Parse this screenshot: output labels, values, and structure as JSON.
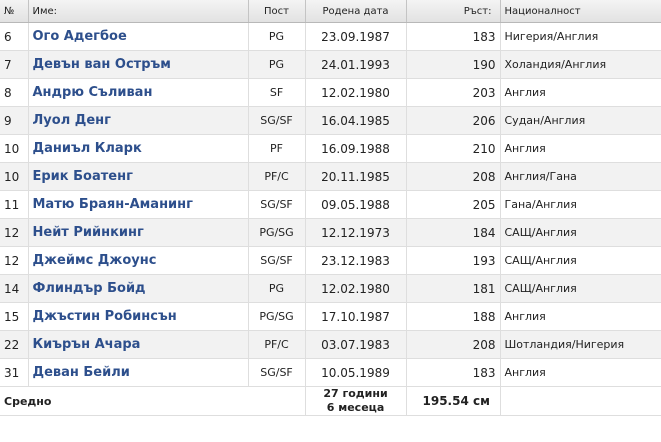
{
  "table": {
    "headers": {
      "number": "№",
      "name": "Име:",
      "position": "Пост",
      "birth_date": "Родена дата",
      "height": "Ръст:",
      "nationality": "Националност"
    },
    "rows": [
      {
        "number": "6",
        "name": "Ого Адегбое",
        "position": "PG",
        "birth_date": "23.09.1987",
        "height": "183",
        "nationality": "Нигерия/Англия"
      },
      {
        "number": "7",
        "name": "Девън ван Остръм",
        "position": "PG",
        "birth_date": "24.01.1993",
        "height": "190",
        "nationality": "Холандия/Англия"
      },
      {
        "number": "8",
        "name": "Андрю Съливан",
        "position": "SF",
        "birth_date": "12.02.1980",
        "height": "203",
        "nationality": "Англия"
      },
      {
        "number": "9",
        "name": "Луол Денг",
        "position": "SG/SF",
        "birth_date": "16.04.1985",
        "height": "206",
        "nationality": "Судан/Англия"
      },
      {
        "number": "10",
        "name": "Даниъл Кларк",
        "position": "PF",
        "birth_date": "16.09.1988",
        "height": "210",
        "nationality": "Англия"
      },
      {
        "number": "10",
        "name": "Ерик Боатенг",
        "position": "PF/C",
        "birth_date": "20.11.1985",
        "height": "208",
        "nationality": "Англия/Гана"
      },
      {
        "number": "11",
        "name": "Матю Браян-Аманинг",
        "position": "SG/SF",
        "birth_date": "09.05.1988",
        "height": "205",
        "nationality": "Гана/Англия"
      },
      {
        "number": "12",
        "name": "Нейт Рийнкинг",
        "position": "PG/SG",
        "birth_date": "12.12.1973",
        "height": "184",
        "nationality": "САЩ/Англия"
      },
      {
        "number": "12",
        "name": "Джеймс Джоунс",
        "position": "SG/SF",
        "birth_date": "23.12.1983",
        "height": "193",
        "nationality": "САЩ/Англия"
      },
      {
        "number": "14",
        "name": "Флиндър Бойд",
        "position": "PG",
        "birth_date": "12.02.1980",
        "height": "181",
        "nationality": "САЩ/Англия"
      },
      {
        "number": "15",
        "name": "Джъстин Робинсън",
        "position": "PG/SG",
        "birth_date": "17.10.1987",
        "height": "188",
        "nationality": "Англия"
      },
      {
        "number": "22",
        "name": "Киърън Ачара",
        "position": "PF/C",
        "birth_date": "03.07.1983",
        "height": "208",
        "nationality": "Шотландия/Нигерия"
      },
      {
        "number": "31",
        "name": "Деван Бейли",
        "position": "SG/SF",
        "birth_date": "10.05.1989",
        "height": "183",
        "nationality": "Англия"
      }
    ],
    "footer": {
      "label": "Средно",
      "age_line1": "27 години",
      "age_line2": "6 месеца",
      "height": "195.54 см"
    }
  }
}
